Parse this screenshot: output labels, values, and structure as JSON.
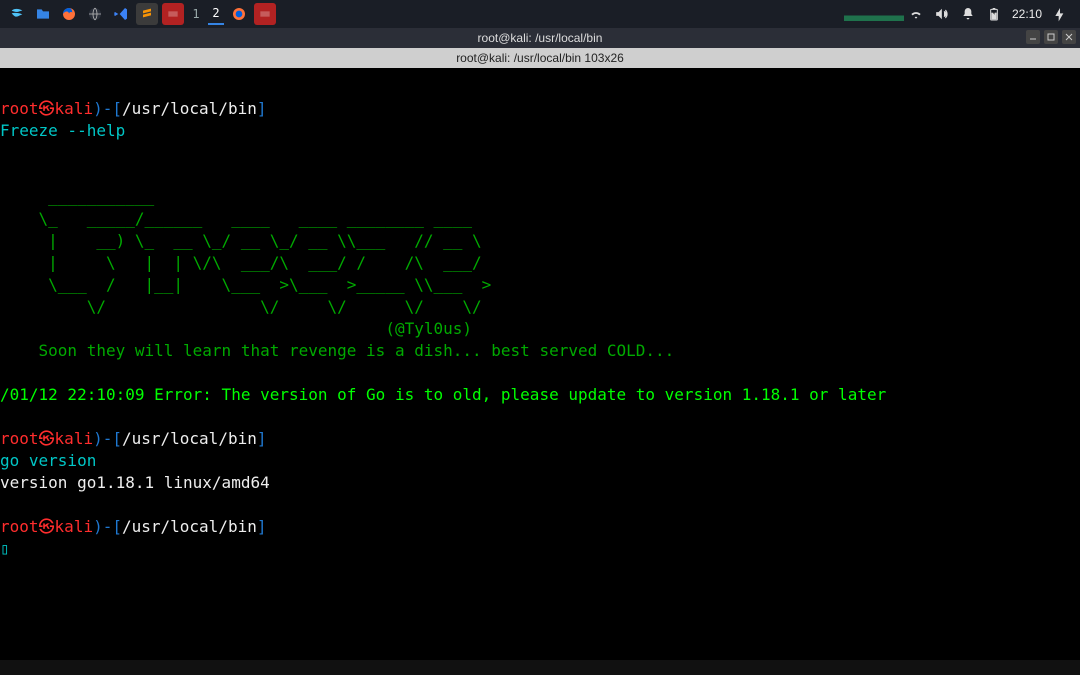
{
  "taskbar": {
    "icons": [
      {
        "name": "kali-menu-icon"
      },
      {
        "name": "files-icon"
      },
      {
        "name": "firefox-esr-icon"
      },
      {
        "name": "browser-icon"
      },
      {
        "name": "vscode-icon"
      },
      {
        "name": "sublime-icon"
      },
      {
        "name": "app-red-icon-1"
      }
    ],
    "workspaces": [
      {
        "label": "1",
        "active": false
      },
      {
        "label": "2",
        "active": true
      }
    ],
    "apps": [
      {
        "name": "firefox-running-icon"
      },
      {
        "name": "app-red-icon-2"
      }
    ],
    "tray": {
      "wifi": true,
      "volume": true,
      "notifications": true,
      "battery": true,
      "clock": "22:10"
    }
  },
  "window": {
    "title": "root@kali: /usr/local/bin"
  },
  "tab": {
    "title": "root@kali: /usr/local/bin 103x26"
  },
  "terminal": {
    "prompt": {
      "user": "root",
      "host": "kali",
      "sep_close": ")-[",
      "path": "/usr/local/bin",
      "end": "]"
    },
    "cmd1": "Freeze --help",
    "ascii": [
      "     ___________                                        ",
      "    \\_   _____/______   ____   ____ ________ ____       ",
      "     |    __) \\_  __ \\_/ __ \\_/ __ \\\\___   // __ \\      ",
      "     |     \\   |  | \\/\\  ___/\\  ___/ /    /\\  ___/      ",
      "     \\___  /   |__|    \\___  >\\___  >_____ \\\\___  >     ",
      "         \\/                \\/     \\/      \\/    \\/      "
    ],
    "author": "                                        (@Tyl0us)",
    "tag": "    Soon they will learn that revenge is a dish... best served COLD...",
    "err": "/01/12 22:10:09 Error: The version of Go is to old, please update to version 1.18.1 or later",
    "cmd2": "go version",
    "out2": "version go1.18.1 linux/amd64"
  }
}
